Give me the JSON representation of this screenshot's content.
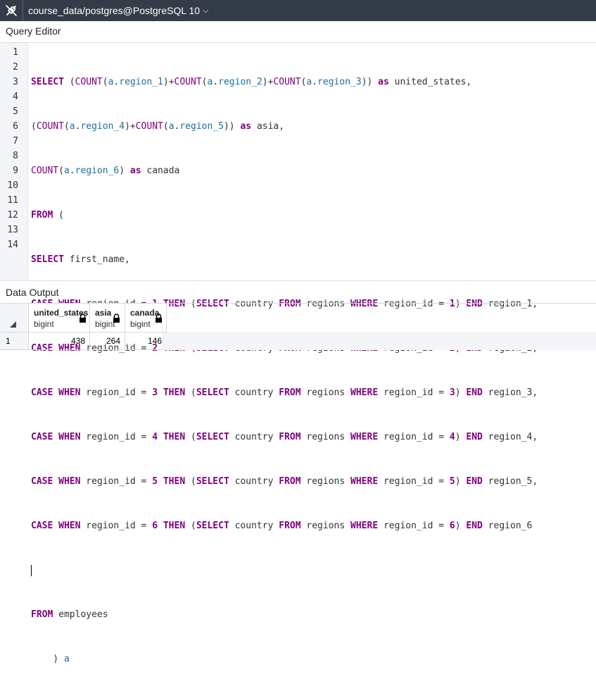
{
  "titlebar": {
    "connection": "course_data/postgres@PostgreSQL 10",
    "connection_icon": "plug-disconnect-icon",
    "dropdown_icon": "chevron-down-icon"
  },
  "query_editor": {
    "title": "Query Editor",
    "line_numbers": [
      "1",
      "2",
      "3",
      "4",
      "5",
      "6",
      "7",
      "8",
      "9",
      "10",
      "11",
      "12",
      "13",
      "14"
    ]
  },
  "data_output": {
    "title": "Data Output",
    "columns": [
      {
        "name": "united_states",
        "type": "bigint"
      },
      {
        "name": "asia",
        "type": "bigint"
      },
      {
        "name": "canada",
        "type": "bigint"
      }
    ],
    "rows": [
      {
        "index": "1",
        "values": [
          "438",
          "264",
          "146"
        ]
      }
    ],
    "colors": {
      "header_bg": "#333c48",
      "keyword": "#800080",
      "identifier": "#1d6f9e"
    }
  }
}
